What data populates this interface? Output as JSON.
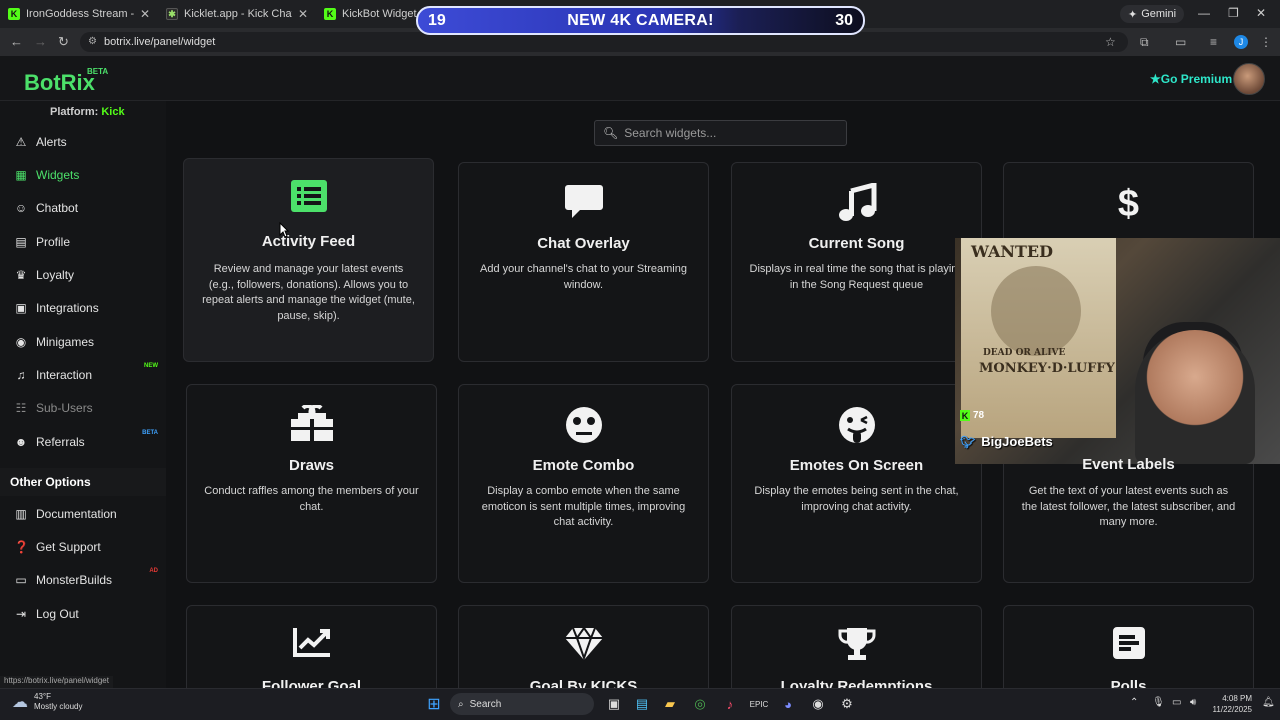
{
  "browser": {
    "tabs": [
      {
        "title": "IronGoddess Stream - Watch Live",
        "favicon": "kick-icon"
      },
      {
        "title": "Kicklet.app - Kick Chatbot and Overlays",
        "favicon": "kicklet-icon"
      },
      {
        "title": "KickBot Widget Library",
        "favicon": "kick-icon"
      }
    ],
    "gemini_label": "Gemini",
    "url": "botrix.live/panel/widget"
  },
  "stream_banner": {
    "left_num": "19",
    "text": "NEW 4K CAMERA!",
    "right_num": "30"
  },
  "app": {
    "logo": "BotRix",
    "logo_badge": "BETA",
    "premium_label": "Go Premium",
    "platform_label": "Platform:",
    "platform_value": "Kick"
  },
  "sidebar": {
    "items": [
      {
        "label": "Alerts",
        "icon": "warning-icon"
      },
      {
        "label": "Widgets",
        "icon": "grid-icon"
      },
      {
        "label": "Chatbot",
        "icon": "robot-icon"
      },
      {
        "label": "Profile",
        "icon": "id-card-icon"
      },
      {
        "label": "Loyalty",
        "icon": "trophy-icon"
      },
      {
        "label": "Integrations",
        "icon": "plug-icon"
      },
      {
        "label": "Minigames",
        "icon": "gamepad-icon"
      },
      {
        "label": "Interaction",
        "icon": "music-icon",
        "badge": "NEW"
      },
      {
        "label": "Sub-Users",
        "icon": "users-icon"
      },
      {
        "label": "Referrals",
        "icon": "users-icon",
        "badge": "BETA"
      }
    ],
    "other_heading": "Other Options",
    "other_items": [
      {
        "label": "Documentation",
        "icon": "book-icon"
      },
      {
        "label": "Get Support",
        "icon": "question-icon"
      },
      {
        "label": "MonsterBuilds",
        "icon": "monitor-icon",
        "badge": "AD"
      },
      {
        "label": "Log Out",
        "icon": "logout-icon"
      }
    ]
  },
  "search": {
    "placeholder": "Search widgets..."
  },
  "cards": [
    {
      "title": "Activity Feed",
      "icon": "list-icon",
      "desc": "Review and manage your latest events (e.g., followers, donations). Allows you to repeat alerts and manage the widget (mute, pause, skip)."
    },
    {
      "title": "Chat Overlay",
      "icon": "chat-icon",
      "desc": "Add your channel's chat to your Streaming window."
    },
    {
      "title": "Current Song",
      "icon": "music-icon",
      "desc": "Displays in real time the song that is playing in the Song Request queue"
    },
    {
      "title": "",
      "icon": "dollar-icon",
      "desc": ""
    },
    {
      "title": "Draws",
      "icon": "gift-icon",
      "desc": "Conduct raffles among the members of your chat."
    },
    {
      "title": "Emote Combo",
      "icon": "face-icon",
      "desc": "Display a combo emote when the same emoticon is sent multiple times, improving chat activity."
    },
    {
      "title": "Emotes On Screen",
      "icon": "tongue-face-icon",
      "desc": "Display the emotes being sent in the chat, improving chat activity."
    },
    {
      "title": "Event Labels",
      "icon": "",
      "desc": "Get the text of your latest events such as the latest follower, the latest subscriber, and many more."
    },
    {
      "title": "Follower Goal",
      "icon": "chart-icon",
      "desc": ""
    },
    {
      "title": "Goal By KICKS",
      "icon": "diamond-icon",
      "desc": ""
    },
    {
      "title": "Loyalty Redemptions",
      "icon": "trophy-icon",
      "desc": ""
    },
    {
      "title": "Polls",
      "icon": "poll-icon",
      "desc": ""
    }
  ],
  "webcam": {
    "poster_title": "WANTED",
    "poster_dead": "DEAD OR ALIVE",
    "poster_name": "MONKEY·D·LUFFY",
    "kick_count": "78",
    "handle": "BigJoeBets"
  },
  "status_url": "https://botrix.live/panel/widget",
  "taskbar": {
    "temp": "43°F",
    "weather": "Mostly cloudy",
    "search_label": "Search",
    "time": "4:08 PM",
    "date": "11/22/2025"
  },
  "colors": {
    "accent": "#4ce06a",
    "kick": "#53fc18",
    "premium": "#2ee6c9"
  }
}
